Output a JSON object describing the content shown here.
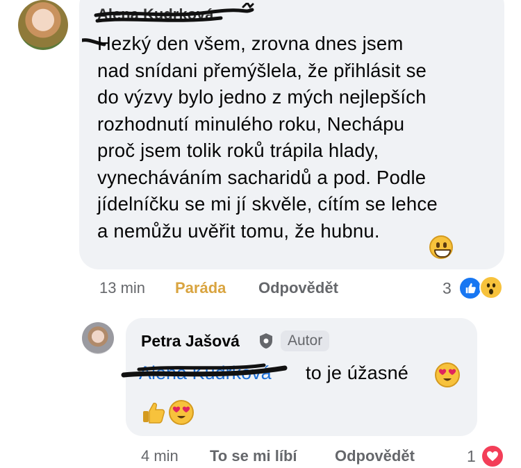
{
  "comment1": {
    "author": "Alena Kudrková",
    "text": "Hezký den všem, zrovna dnes jsem\nnad snídani přemýšlela, že přihlásit se\ndo výzvy bylo jedno z mých nejlepších\nrozhodnutí minulého roku, Nechápu\nproč jsem tolik roků trápila hlady,\nvynecháváním sacharidů a pod. Podle\njídelníčku se mi jí skvěle, cítím se lehce\na nemůžu uvěřit tomu, že hubnu.",
    "time": "13 min",
    "reaction_label": "Paráda",
    "reply_label": "Odpovědět",
    "reaction_count": "3",
    "reactions": [
      "like-icon",
      "wow-icon"
    ]
  },
  "comment2": {
    "author": "Petra Jašová",
    "badge": "Autor",
    "mention": "Alena Kudrková",
    "text": "to je úžasné",
    "time": "4 min",
    "like_label": "To se mi líbí",
    "reply_label": "Odpovědět",
    "reaction_count": "1",
    "reactions": [
      "love-icon"
    ]
  },
  "colors": {
    "bubble": "#f0f2f5",
    "meta": "#65676b",
    "reaction_active": "#d9a440",
    "mention": "#1d6fd6",
    "like_blue": "#1877f2",
    "love_red": "#f33e58"
  }
}
